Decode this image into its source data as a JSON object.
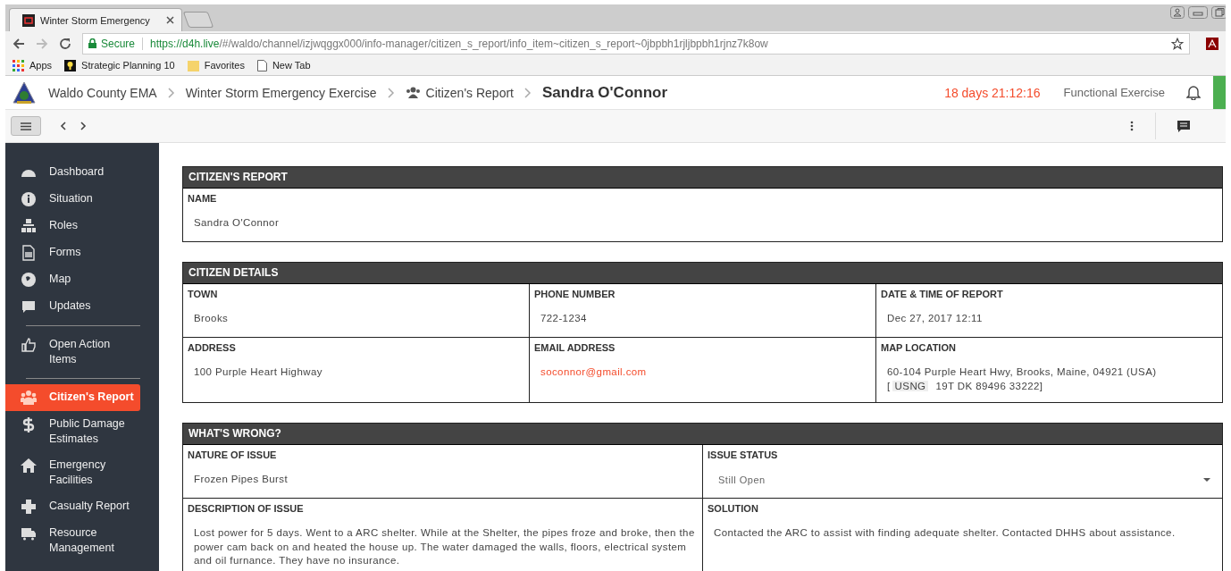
{
  "browser": {
    "tabs": [
      {
        "title": "Winter Storm Emergency",
        "selected": true
      }
    ],
    "address": {
      "secure_label": "Secure",
      "host": "https://d4h.live",
      "path": "/#/waldo/channel/izjwqggx000/info-manager/citizen_s_report/info_item~citizen_s_report~0jbpbh1rjljbpbh1rjnz7k8ow"
    },
    "bookmarks": [
      {
        "label": "Apps"
      },
      {
        "label": "Strategic Planning 10"
      },
      {
        "label": "Favorites"
      },
      {
        "label": "New Tab"
      }
    ]
  },
  "header": {
    "breadcrumbs": [
      "Waldo County EMA",
      "Winter Storm Emergency Exercise",
      "Citizen's Report"
    ],
    "title": "Sandra O'Connor",
    "countdown": "18 days 21:12:16",
    "mode": "Functional Exercise"
  },
  "sidebar": {
    "items": [
      {
        "kind": "item",
        "label": "Dashboard",
        "selected": false
      },
      {
        "kind": "item",
        "label": "Situation",
        "selected": false
      },
      {
        "kind": "item",
        "label": "Roles",
        "selected": false
      },
      {
        "kind": "item",
        "label": "Forms",
        "selected": false
      },
      {
        "kind": "item",
        "label": "Map",
        "selected": false
      },
      {
        "kind": "item",
        "label": "Updates",
        "selected": false
      },
      {
        "kind": "divider"
      },
      {
        "kind": "item",
        "label": "Open Action Items",
        "selected": false
      },
      {
        "kind": "divider"
      },
      {
        "kind": "item",
        "label": "Citizen's Report",
        "selected": true
      },
      {
        "kind": "item",
        "label": "Public Damage Estimates",
        "selected": false
      },
      {
        "kind": "item",
        "label": "Emergency Facilities",
        "selected": false
      },
      {
        "kind": "item",
        "label": "Casualty Report",
        "selected": false
      },
      {
        "kind": "item",
        "label": "Resource Management",
        "selected": false
      }
    ]
  },
  "sections": [
    {
      "title": "CITIZEN'S REPORT",
      "rows": [
        [
          {
            "label": "NAME",
            "kind": "text",
            "value": "Sandra O'Connor"
          }
        ]
      ]
    },
    {
      "title": "CITIZEN DETAILS",
      "rows": [
        [
          {
            "label": "TOWN",
            "kind": "text",
            "value": "Brooks"
          },
          {
            "label": "PHONE NUMBER",
            "kind": "text",
            "value": "722-1234"
          },
          {
            "label": "DATE & TIME OF REPORT",
            "kind": "text",
            "value": "Dec 27, 2017 12:11"
          }
        ],
        [
          {
            "label": "ADDRESS",
            "kind": "text",
            "value": "100 Purple Heart Highway"
          },
          {
            "label": "EMAIL ADDRESS",
            "kind": "link",
            "value": "soconnor@gmail.com"
          },
          {
            "label": "MAP LOCATION",
            "kind": "location",
            "value": "60-104 Purple Heart Hwy, Brooks, Maine, 04921 (USA)",
            "grid_open": "[",
            "grid_tag": "USNG",
            "grid_ref": "19T DK 89496 33222]"
          }
        ]
      ]
    },
    {
      "title": "WHAT'S WRONG?",
      "rows": [
        [
          {
            "label": "NATURE OF ISSUE",
            "kind": "text",
            "value": "Frozen Pipes Burst"
          },
          {
            "label": "ISSUE STATUS",
            "kind": "select",
            "value": "Still Open"
          }
        ],
        [
          {
            "label": "DESCRIPTION OF ISSUE",
            "kind": "text",
            "value": "Lost power for 5 days. Went to a ARC shelter. While at the Shelter, the pipes froze and broke, then the power cam back on and heated the house up. The water damaged the walls, floors, electrical system and oil furnance. They have no insurance."
          },
          {
            "label": "SOLUTION",
            "kind": "text",
            "value": "Contacted the ARC to assist with finding adequate shelter. Contacted DHHS about assistance."
          }
        ]
      ]
    }
  ]
}
